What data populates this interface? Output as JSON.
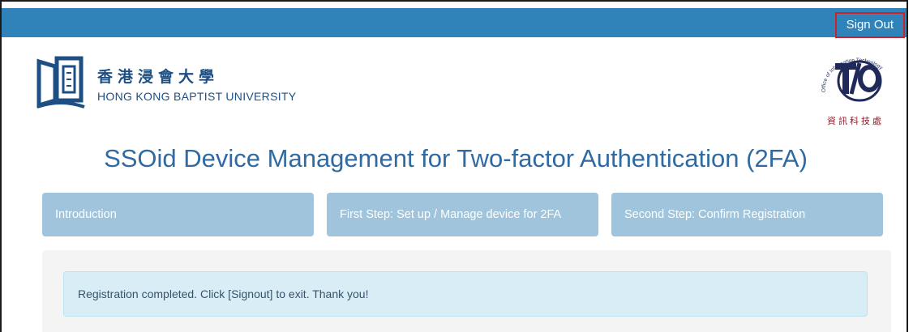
{
  "header": {
    "signout_label": "Sign Out"
  },
  "branding": {
    "university_zh": "香港浸會大學",
    "university_en": "HONG KONG BAPTIST UNIVERSITY",
    "ito_ring_text": "Office of Information Technology",
    "ito_zh": "資訊科技處"
  },
  "page": {
    "title": "SSOid Device Management for Two-factor Authentication (2FA)"
  },
  "steps": [
    {
      "label": "Introduction"
    },
    {
      "label": "First Step: Set up / Manage device for 2FA"
    },
    {
      "label": "Second Step: Confirm Registration"
    }
  ],
  "alert": {
    "message": "Registration completed. Click [Signout] to exit. Thank you!"
  },
  "colors": {
    "topbar": "#2f83b9",
    "signout_border": "#d0202a",
    "step_bg": "#9fc4dc",
    "title": "#2f6aa3",
    "alert_bg": "#d9edf7"
  },
  "icons": {
    "logo": "hkbu-logo-icon",
    "ito": "ito-logo-icon"
  }
}
